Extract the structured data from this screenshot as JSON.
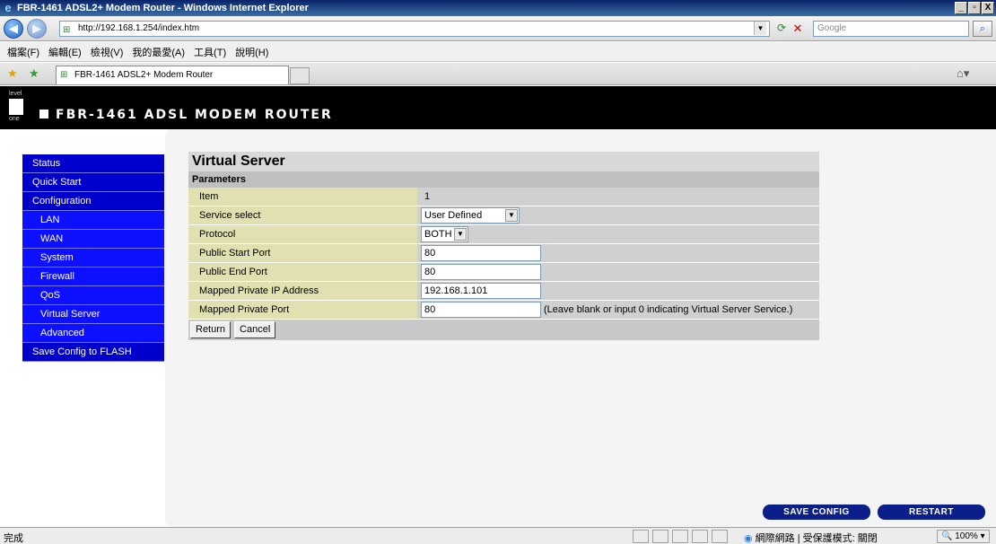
{
  "window": {
    "title": "FBR-1461 ADSL2+ Modem Router - Windows Internet Explorer",
    "min": "_",
    "max": "▫",
    "close": "X"
  },
  "address": {
    "url": "http://192.168.1.254/index.htm",
    "search_placeholder": "Google"
  },
  "menu": [
    "檔案(F)",
    "編輯(E)",
    "檢視(V)",
    "我的最愛(A)",
    "工具(T)",
    "說明(H)"
  ],
  "tab": {
    "title": "FBR-1461 ADSL2+ Modem Router"
  },
  "header": {
    "logo_top": "level",
    "logo_bottom": "one",
    "brand": "FBR-1461 ADSL MODEM ROUTER"
  },
  "nav": {
    "status": "Status",
    "quick_start": "Quick Start",
    "configuration": "Configuration",
    "lan": "LAN",
    "wan": "WAN",
    "system": "System",
    "firewall": "Firewall",
    "qos": "QoS",
    "virtual_server": "Virtual Server",
    "advanced": "Advanced",
    "save_config": "Save Config to FLASH"
  },
  "content": {
    "title": "Virtual Server",
    "section": "Parameters",
    "rows": {
      "item_label": "Item",
      "item_value": "1",
      "service_label": "Service select",
      "service_value": "User Defined",
      "protocol_label": "Protocol",
      "protocol_value": "BOTH",
      "start_port_label": "Public Start Port",
      "start_port_value": "80",
      "end_port_label": "Public End Port",
      "end_port_value": "80",
      "ip_label": "Mapped Private IP Address",
      "ip_value": "192.168.1.101",
      "private_port_label": "Mapped Private Port",
      "private_port_value": "80",
      "private_port_note": "(Leave blank or input 0 indicating Virtual Server Service.)"
    },
    "return_label": "Return",
    "cancel_label": "Cancel"
  },
  "footer": {
    "save_config": "SAVE CONFIG",
    "restart": "RESTART"
  },
  "status": {
    "text": "完成",
    "zone": "網際網路 | 受保護模式: 關閉",
    "zoom": "100%"
  }
}
